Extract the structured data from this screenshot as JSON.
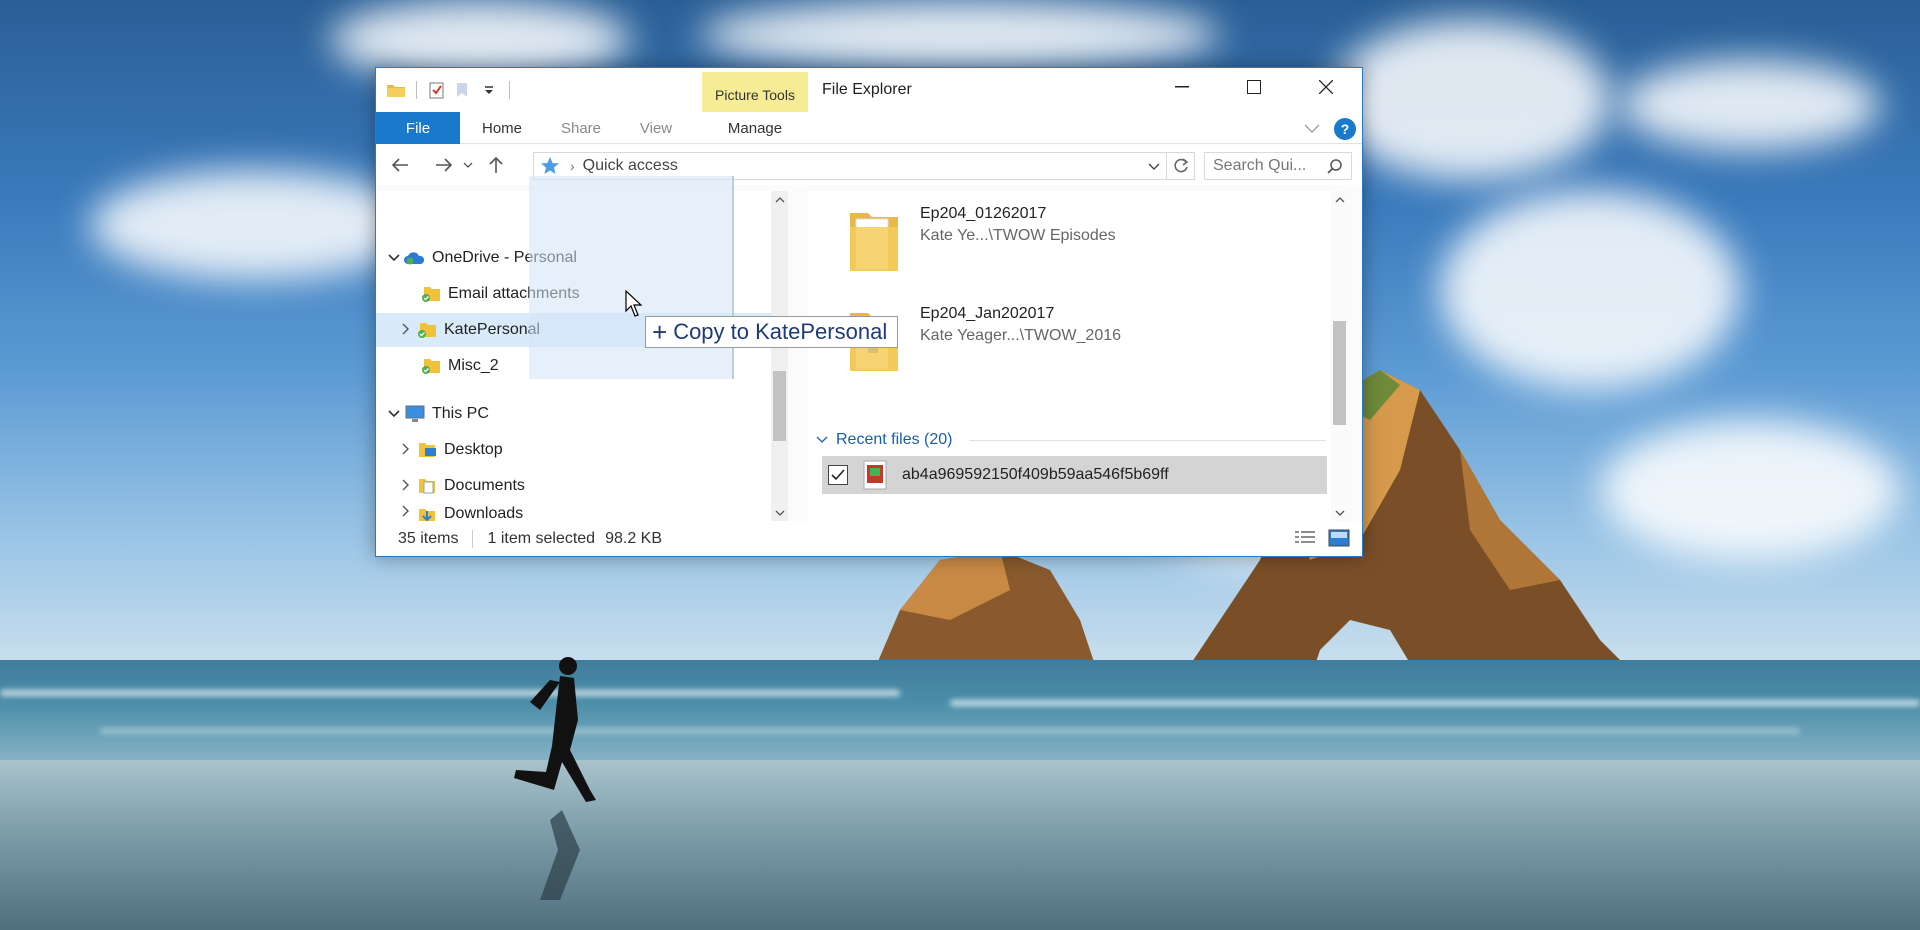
{
  "window": {
    "title": "File Explorer",
    "contextual_tab_group": "Picture Tools",
    "min_label": "—",
    "max_label": "☐",
    "close_label": "✕"
  },
  "ribbon": {
    "tabs": [
      {
        "label": "File"
      },
      {
        "label": "Home"
      },
      {
        "label": "Share"
      },
      {
        "label": "View"
      },
      {
        "label": "Manage"
      }
    ],
    "help_label": "?"
  },
  "navigation": {
    "back": "←",
    "forward": "→",
    "recent": "⌄",
    "up": "↑",
    "breadcrumb_sep": "›",
    "address": "Quick access",
    "search_placeholder": "Search Qui..."
  },
  "tree": {
    "items": [
      {
        "label": "OneDrive - Personal",
        "expanded": true
      },
      {
        "label": "Email attachments"
      },
      {
        "label": "KatePersonal",
        "hovered": true
      },
      {
        "label": "Misc_2"
      },
      {
        "label": "This PC",
        "expanded": true
      },
      {
        "label": "Desktop"
      },
      {
        "label": "Documents"
      },
      {
        "label": "Downloads"
      }
    ]
  },
  "drag": {
    "plus": "+",
    "action_text": "Copy to KatePersonal"
  },
  "content": {
    "folders": [
      {
        "name": "Ep204_01262017",
        "path": "Kate Ye...\\TWOW Episodes"
      },
      {
        "name": "Ep204_Jan202017",
        "path": "Kate Yeager...\\TWOW_2016"
      }
    ],
    "recent_header": "Recent files (20)",
    "recent_files": [
      {
        "name": "ab4a969592150f409b59aa546f5b69ff",
        "checked": true
      }
    ]
  },
  "status": {
    "item_count": "35 items",
    "selected": "1 item selected",
    "size": "98.2 KB"
  },
  "colors": {
    "accent": "#1979ca",
    "picture_tools": "#f6ec95",
    "hover": "#d9ebfa"
  }
}
